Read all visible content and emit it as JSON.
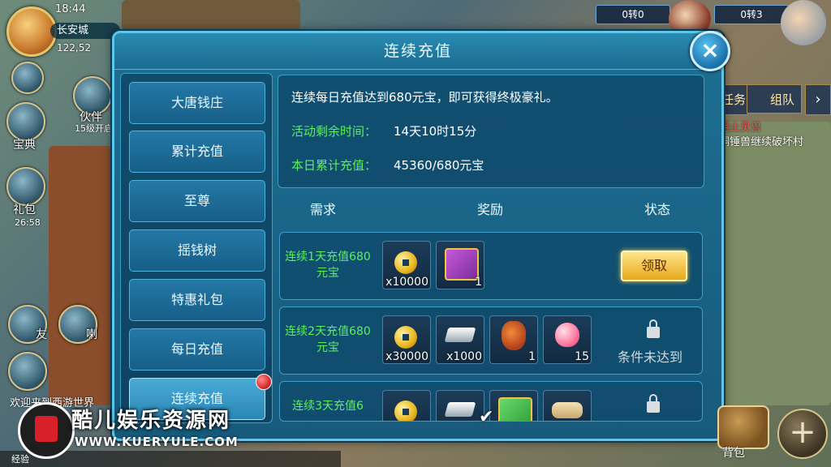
{
  "hud": {
    "time": "18:44",
    "location": "长安城",
    "coords": "122,52",
    "left_buttons": {
      "treasure": "宝典",
      "gift": "礼包",
      "gift_timer": "26:58",
      "partner": "伙伴",
      "partner_hint": "15级开启",
      "friend": "友",
      "voice": "喇"
    },
    "right": {
      "score_left": "0转0",
      "score_right": "0转3",
      "task_tab": "任务",
      "team_tab": "组队",
      "quest_line1": "阻止灵兽",
      "quest_line2": "铜锤兽继续破坏村"
    },
    "bottom": {
      "exp_label": "经验",
      "chat_snippet": "欢迎来到西游世界",
      "bag_label": "背包"
    }
  },
  "panel": {
    "title": "连续充值",
    "close_label": "×",
    "sidebar": [
      {
        "label": "大唐钱庄",
        "active": false
      },
      {
        "label": "累计充值",
        "active": false
      },
      {
        "label": "至尊",
        "active": false
      },
      {
        "label": "摇钱树",
        "active": false
      },
      {
        "label": "特惠礼包",
        "active": false
      },
      {
        "label": "每日充值",
        "active": false
      },
      {
        "label": "连续充值",
        "active": true
      }
    ],
    "info": {
      "description": "连续每日充值达到680元宝，即可获得终极豪礼。",
      "remaining_label": "活动剩余时间：",
      "remaining_value": "14天10时15分",
      "today_label": "本日累计充值：",
      "today_value": "45360/680元宝"
    },
    "headers": {
      "requirement": "需求",
      "reward": "奖励",
      "status": "状态"
    },
    "rows": [
      {
        "label": "连续1天充值680元宝",
        "items": [
          {
            "icon": "coin-icon",
            "qty": "x10000"
          },
          {
            "icon": "gift-box-icon",
            "qty": "1"
          }
        ],
        "status": "领取",
        "status_type": "claim"
      },
      {
        "label": "连续2天充值680元宝",
        "items": [
          {
            "icon": "coin-icon",
            "qty": "x30000"
          },
          {
            "icon": "silver-ingot-icon",
            "qty": "x1000"
          },
          {
            "icon": "treasure-bag-icon",
            "qty": "1"
          },
          {
            "icon": "peach-icon",
            "qty": "15"
          }
        ],
        "status": "条件未达到",
        "status_type": "locked"
      },
      {
        "label": "连续3天充值6",
        "items": [
          {
            "icon": "coin-icon",
            "qty": ""
          },
          {
            "icon": "silver-ingot-icon",
            "qty": ""
          },
          {
            "icon": "gift-box-icon",
            "qty": ""
          },
          {
            "icon": "scroll-icon",
            "qty": ""
          }
        ],
        "status": "",
        "status_type": "locked"
      }
    ]
  },
  "watermark": {
    "title": "酷儿娱乐资源网",
    "url": "WWW.KUERYULE.COM"
  },
  "colors": {
    "panel_bg": "#1d6f93",
    "accent_green": "#5df05d",
    "claim_gold": "#e6a91c"
  }
}
